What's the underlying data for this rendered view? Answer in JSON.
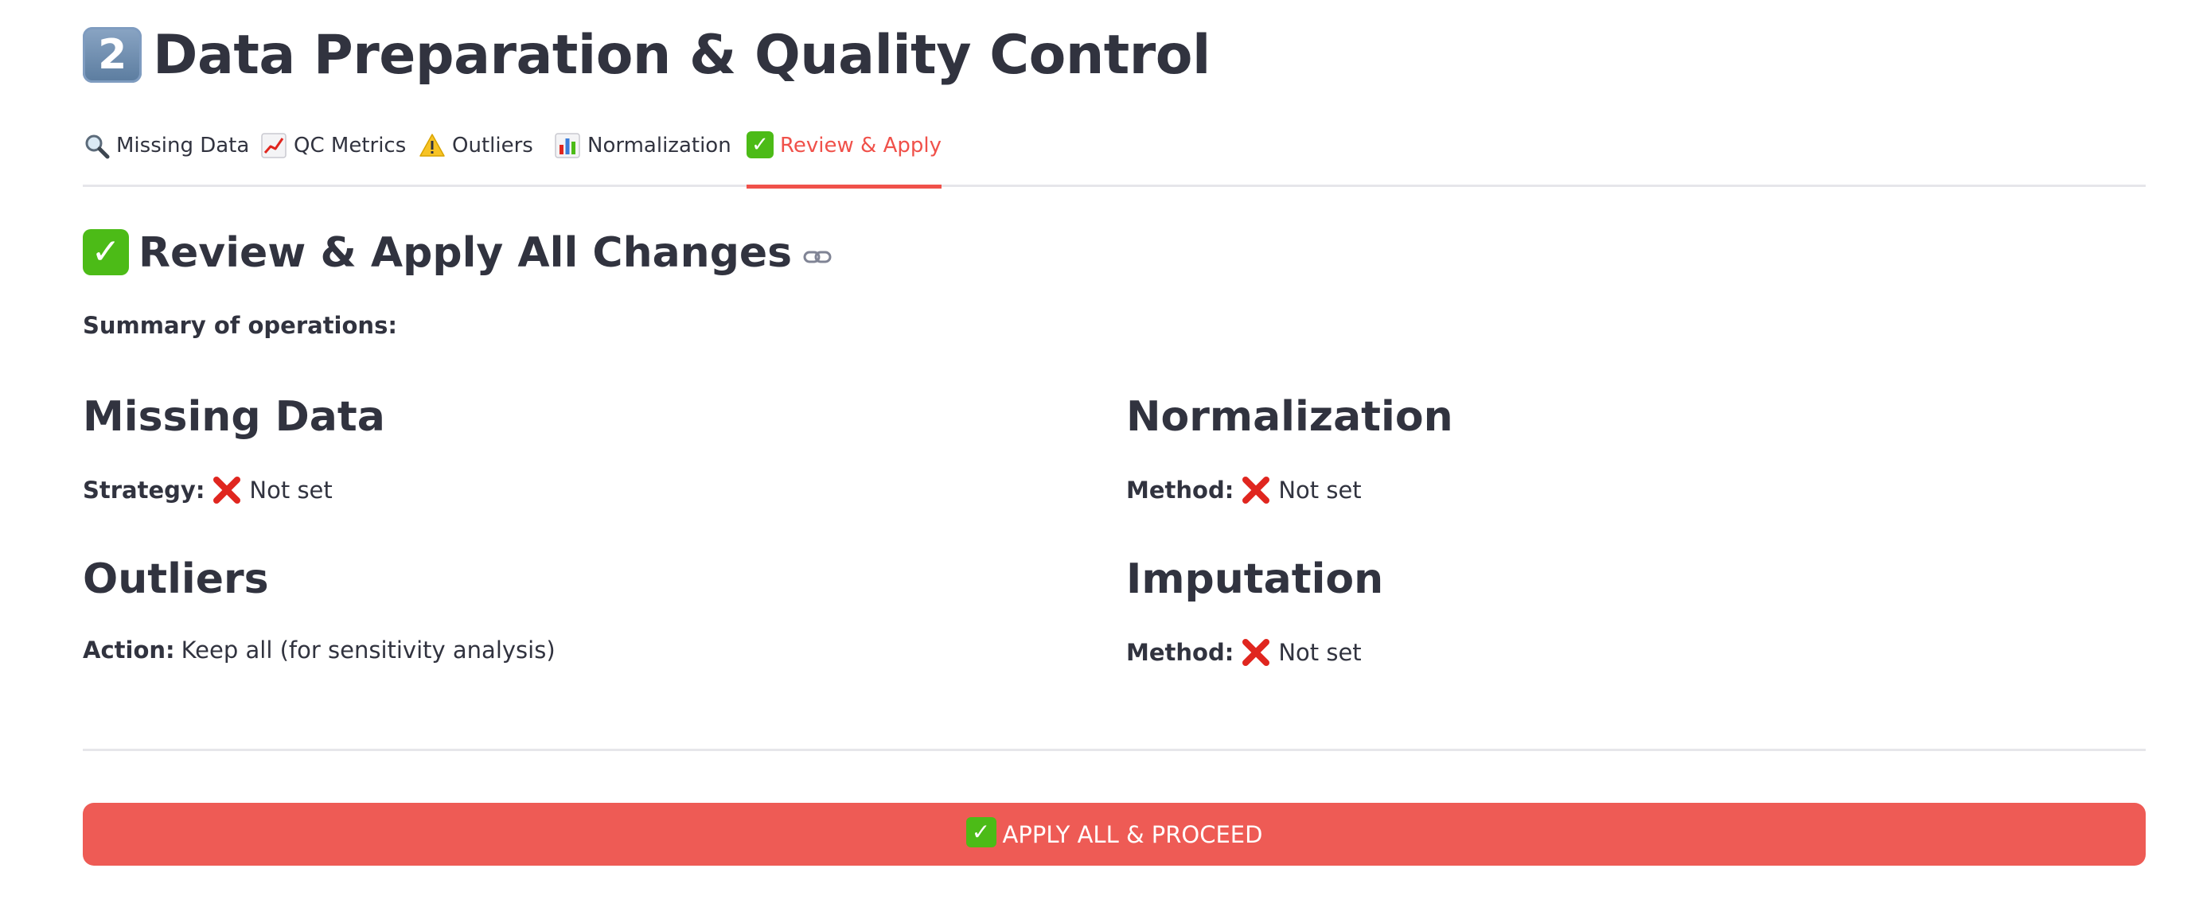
{
  "header": {
    "step_number": "2",
    "title": "Data Preparation & Quality Control"
  },
  "tabs": [
    {
      "label": "Missing Data",
      "icon": "magnifier-icon",
      "active": false
    },
    {
      "label": "QC Metrics",
      "icon": "line-chart-icon",
      "active": false
    },
    {
      "label": "Outliers",
      "icon": "warning-icon",
      "active": false
    },
    {
      "label": "Normalization",
      "icon": "bar-chart-icon",
      "active": false
    },
    {
      "label": "Review & Apply",
      "icon": "check-icon",
      "active": true
    }
  ],
  "review": {
    "title": "Review & Apply All Changes",
    "summary_label": "Summary of operations:",
    "sections": {
      "missing_data": {
        "heading": "Missing Data",
        "key": "Strategy:",
        "value": "Not set",
        "status_icon": "cross-icon"
      },
      "normalization": {
        "heading": "Normalization",
        "key": "Method:",
        "value": "Not set",
        "status_icon": "cross-icon"
      },
      "outliers": {
        "heading": "Outliers",
        "key": "Action:",
        "value": "Keep all (for sensitivity analysis)"
      },
      "imputation": {
        "heading": "Imputation",
        "key": "Method:",
        "value": "Not set",
        "status_icon": "cross-icon"
      }
    }
  },
  "apply_button": {
    "label": "APPLY ALL & PROCEED"
  },
  "colors": {
    "accent": "#f0514a",
    "button": "#ee5b55",
    "text": "#31333f",
    "divider": "#e6e6ea",
    "check": "#4cbb17",
    "cross": "#e0261f"
  }
}
